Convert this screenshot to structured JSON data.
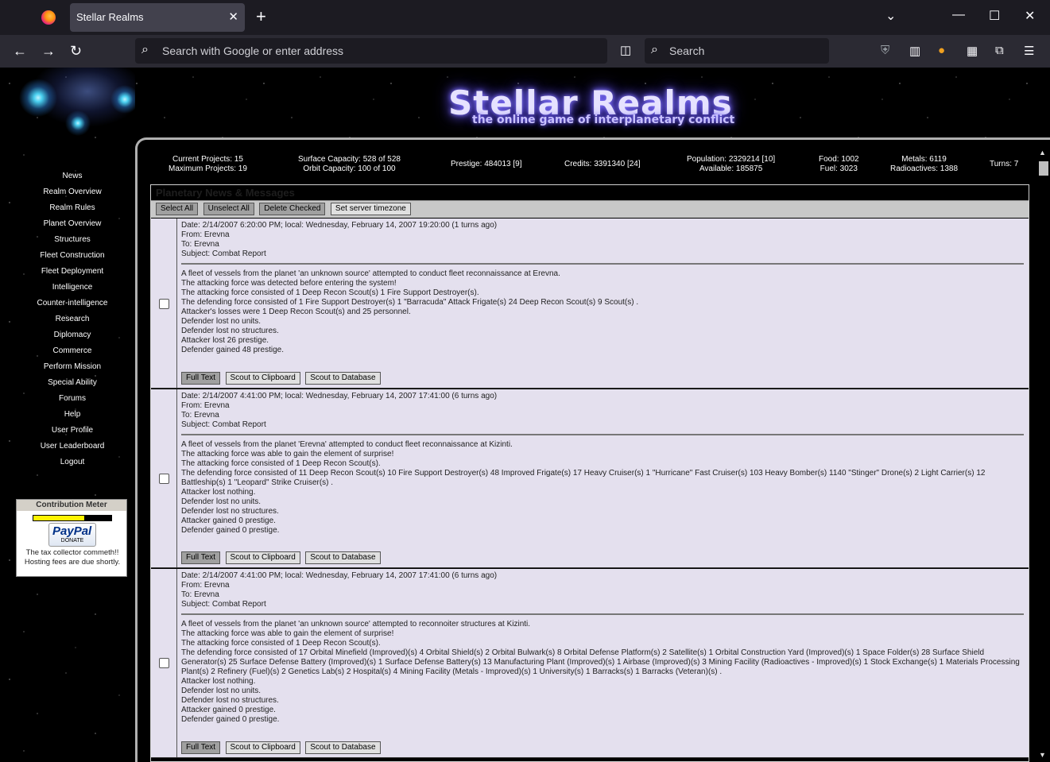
{
  "browser": {
    "tab_title": "Stellar Realms",
    "url_placeholder": "Search with Google or enter address",
    "search_placeholder": "Search"
  },
  "site": {
    "title": "Stellar Realms",
    "subtitle": "the online game of interplanetary conflict"
  },
  "nav": [
    "News",
    "Realm Overview",
    "Realm Rules",
    "Planet Overview",
    "Structures",
    "Fleet Construction",
    "Fleet Deployment",
    "Intelligence",
    "Counter-intelligence",
    "Research",
    "Diplomacy",
    "Commerce",
    "Perform Mission",
    "Special Ability",
    "Forums",
    "Help",
    "User Profile",
    "User Leaderboard",
    "Logout"
  ],
  "meter": {
    "title": "Contribution Meter",
    "fill_percent": 65,
    "paypal": "PayPal",
    "donate": "DONATE",
    "text": "The tax collector commeth!! Hosting fees are due shortly."
  },
  "stats": {
    "current_projects": "Current Projects: 15",
    "max_projects": "Maximum Projects: 19",
    "surface_capacity": "Surface Capacity: 528 of 528",
    "orbit_capacity": "Orbit Capacity: 100 of 100",
    "prestige": "Prestige: 484013 [9]",
    "credits": "Credits: 3391340 [24]",
    "population": "Population: 2329214 [10]",
    "available": "Available: 185875",
    "food": "Food: 1002",
    "fuel": "Fuel: 3023",
    "metals": "Metals: 6119",
    "radioactives": "Radioactives: 1388",
    "turns": "Turns: 7"
  },
  "panel": {
    "title": "Planetary News & Messages",
    "select_all": "Select All",
    "unselect_all": "Unselect All",
    "delete_checked": "Delete Checked",
    "set_timezone": "Set server timezone"
  },
  "message_buttons": {
    "full_text": "Full Text",
    "scout_clipboard": "Scout to Clipboard",
    "scout_database": "Scout to Database"
  },
  "messages": [
    {
      "date": "Date: 2/14/2007 6:20:00 PM; local: Wednesday, February 14, 2007 19:20:00 (1 turns ago)",
      "from": "From: Erevna",
      "to": "To: Erevna",
      "subject": "Subject: Combat Report",
      "body": [
        "A fleet of vessels from the planet 'an unknown source' attempted to conduct fleet reconnaissance at Erevna.",
        "The attacking force was detected before entering the system!",
        "The attacking force consisted of 1 Deep Recon Scout(s) 1 Fire Support Destroyer(s).",
        "The defending force consisted of 1 Fire Support Destroyer(s) 1 \"Barracuda\" Attack Frigate(s) 24 Deep Recon Scout(s) 9 Scout(s) .",
        "Attacker's losses were 1 Deep Recon Scout(s) and 25 personnel.",
        "Defender lost no units.",
        "Defender lost no structures.",
        "Attacker lost 26 prestige.",
        "Defender gained 48 prestige."
      ]
    },
    {
      "date": "Date: 2/14/2007 4:41:00 PM; local: Wednesday, February 14, 2007 17:41:00 (6 turns ago)",
      "from": "From: Erevna",
      "to": "To: Erevna",
      "subject": "Subject: Combat Report",
      "body": [
        "A fleet of vessels from the planet 'Erevna' attempted to conduct fleet reconnaissance at Kizinti.",
        "The attacking force was able to gain the element of surprise!",
        "The attacking force consisted of 1 Deep Recon Scout(s).",
        "The defending force consisted of 11 Deep Recon Scout(s) 10 Fire Support Destroyer(s) 48 Improved Frigate(s) 17 Heavy Cruiser(s) 1 \"Hurricane\" Fast Cruiser(s) 103 Heavy Bomber(s) 1140 \"Stinger\" Drone(s) 2 Light Carrier(s) 12 Battleship(s) 1 \"Leopard\" Strike Cruiser(s) .",
        "Attacker lost nothing.",
        "Defender lost no units.",
        "Defender lost no structures.",
        "Attacker gained 0 prestige.",
        "Defender gained 0 prestige."
      ]
    },
    {
      "date": "Date: 2/14/2007 4:41:00 PM; local: Wednesday, February 14, 2007 17:41:00 (6 turns ago)",
      "from": "From: Erevna",
      "to": "To: Erevna",
      "subject": "Subject: Combat Report",
      "body": [
        "A fleet of vessels from the planet 'an unknown source' attempted to reconnoiter structures at Kizinti.",
        "The attacking force was able to gain the element of surprise!",
        "The attacking force consisted of 1 Deep Recon Scout(s).",
        "The defending force consisted of 17 Orbital Minefield (Improved)(s) 4 Orbital Shield(s) 2 Orbital Bulwark(s) 8 Orbital Defense Platform(s) 2 Satellite(s) 1 Orbital Construction Yard (Improved)(s) 1 Space Folder(s) 28 Surface Shield Generator(s) 25 Surface Defense Battery (Improved)(s) 1 Surface Defense Battery(s) 13 Manufacturing Plant (Improved)(s) 1 Airbase (Improved)(s) 3 Mining Facility (Radioactives - Improved)(s) 1 Stock Exchange(s) 1 Materials Processing Plant(s) 2 Refinery (Fuel)(s) 2 Genetics Lab(s) 2 Hospital(s) 4 Mining Facility (Metals - Improved)(s) 1 University(s) 1 Barracks(s) 1 Barracks (Veteran)(s) .",
        "Attacker lost nothing.",
        "Defender lost no units.",
        "Defender lost no structures.",
        "Attacker gained 0 prestige.",
        "Defender gained 0 prestige."
      ]
    }
  ]
}
